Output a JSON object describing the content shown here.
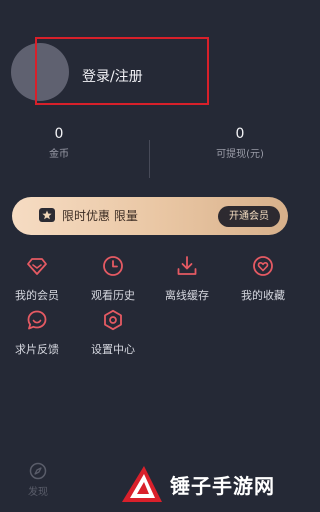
{
  "profile": {
    "login_label": "登录/注册"
  },
  "stats": {
    "coins": {
      "value": "0",
      "label": "金币"
    },
    "withdrawable": {
      "value": "0",
      "label": "可提现(元)"
    }
  },
  "vip_banner": {
    "text": "限时优惠 限量",
    "button_label": "开通会员"
  },
  "menu": [
    {
      "label": "我的会员",
      "icon": "diamond-icon"
    },
    {
      "label": "观看历史",
      "icon": "clock-icon"
    },
    {
      "label": "离线缓存",
      "icon": "download-icon"
    },
    {
      "label": "我的收藏",
      "icon": "heart-icon"
    },
    {
      "label": "求片反馈",
      "icon": "chat-bubble-icon"
    },
    {
      "label": "设置中心",
      "icon": "settings-hexagon-icon"
    }
  ],
  "bottom_nav": {
    "discover_label": "发现"
  },
  "watermark": {
    "text": "锤子手游网"
  },
  "colors": {
    "background": "#252936",
    "accent": "#e55a63",
    "highlight_box": "#d8202a"
  }
}
